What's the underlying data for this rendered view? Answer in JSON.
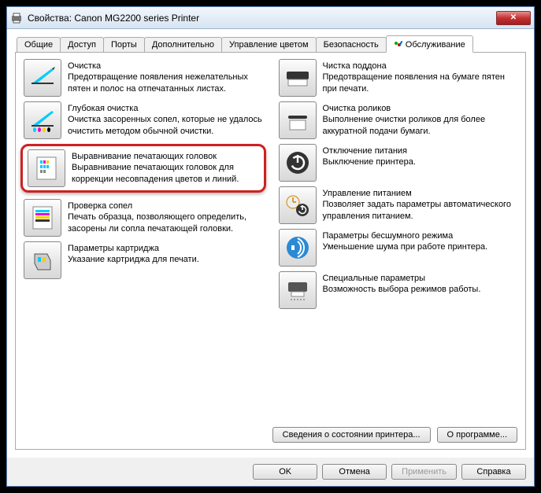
{
  "window": {
    "title": "Свойства: Canon MG2200 series Printer"
  },
  "tabs": [
    {
      "label": "Общие"
    },
    {
      "label": "Доступ"
    },
    {
      "label": "Порты"
    },
    {
      "label": "Дополнительно"
    },
    {
      "label": "Управление цветом"
    },
    {
      "label": "Безопасность"
    },
    {
      "label": "Обслуживание"
    }
  ],
  "left": [
    {
      "title": "Очистка",
      "desc": "Предотвращение появления нежелательных пятен и полос на отпечатанных листах."
    },
    {
      "title": "Глубокая очистка",
      "desc": "Очистка засоренных сопел, которые не удалось очистить методом обычной очистки."
    },
    {
      "title": "Выравнивание печатающих головок",
      "desc": "Выравнивание печатающих головок для коррекции несовпадения цветов и линий."
    },
    {
      "title": "Проверка сопел",
      "desc": "Печать образца, позволяющего определить, засорены ли сопла печатающей головки."
    },
    {
      "title": "Параметры картриджа",
      "desc": "Указание картриджа для печати."
    }
  ],
  "right": [
    {
      "title": "Чистка поддона",
      "desc": "Предотвращение появления на бумаге пятен при печати."
    },
    {
      "title": "Очистка роликов",
      "desc": "Выполнение очистки роликов для более аккуратной подачи бумаги."
    },
    {
      "title": "Отключение питания",
      "desc": "Выключение принтера."
    },
    {
      "title": "Управление питанием",
      "desc": "Позволяет задать параметры автоматического управления питанием."
    },
    {
      "title": "Параметры бесшумного режима",
      "desc": "Уменьшение шума при работе принтера."
    },
    {
      "title": "Специальные параметры",
      "desc": "Возможность выбора режимов работы."
    }
  ],
  "bottom": {
    "status": "Сведения о состоянии принтера...",
    "about": "О программе..."
  },
  "footer": {
    "ok": "OK",
    "cancel": "Отмена",
    "apply": "Применить",
    "help": "Справка"
  }
}
